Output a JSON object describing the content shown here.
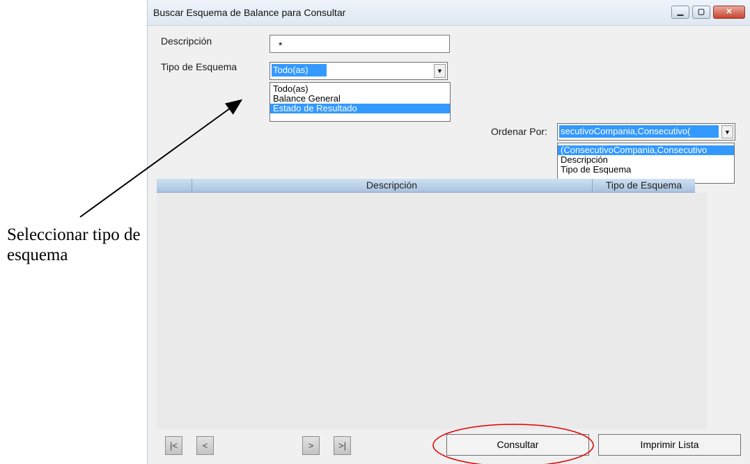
{
  "window": {
    "title": "Buscar Esquema de Balance para Consultar",
    "controls": {
      "minimize_icon": "minimize-icon",
      "maximize_icon": "maximize-icon",
      "close_icon": "close-icon"
    }
  },
  "form": {
    "descripcion_label": "Descripción",
    "descripcion_value": "*",
    "tipo_label": "Tipo de Esquema",
    "tipo_selected": "Todo(as)",
    "tipo_options": [
      "Todo(as)",
      "Balance General",
      "Estado de Resultado"
    ],
    "tipo_highlighted": "Estado de Resultado",
    "ordenar_label": "Ordenar Por:",
    "ordenar_selected": "secutivoCompania,Consecutivo(",
    "ordenar_options": [
      "(ConsecutivoCompania,Consecutivo",
      "Descripción",
      "Tipo de Esquema"
    ]
  },
  "grid": {
    "columns": [
      "Descripción",
      "Tipo de Esquema"
    ]
  },
  "navigation": {
    "first": "|<",
    "prev": "<",
    "next": ">",
    "last": ">|"
  },
  "buttons": {
    "consultar": "Consultar",
    "imprimir": "Imprimir Lista"
  },
  "annotation": {
    "line1": "Seleccionar tipo de",
    "line2": "esquema"
  },
  "colors": {
    "selection": "#3399ff",
    "annotation_circle": "#e00000"
  }
}
